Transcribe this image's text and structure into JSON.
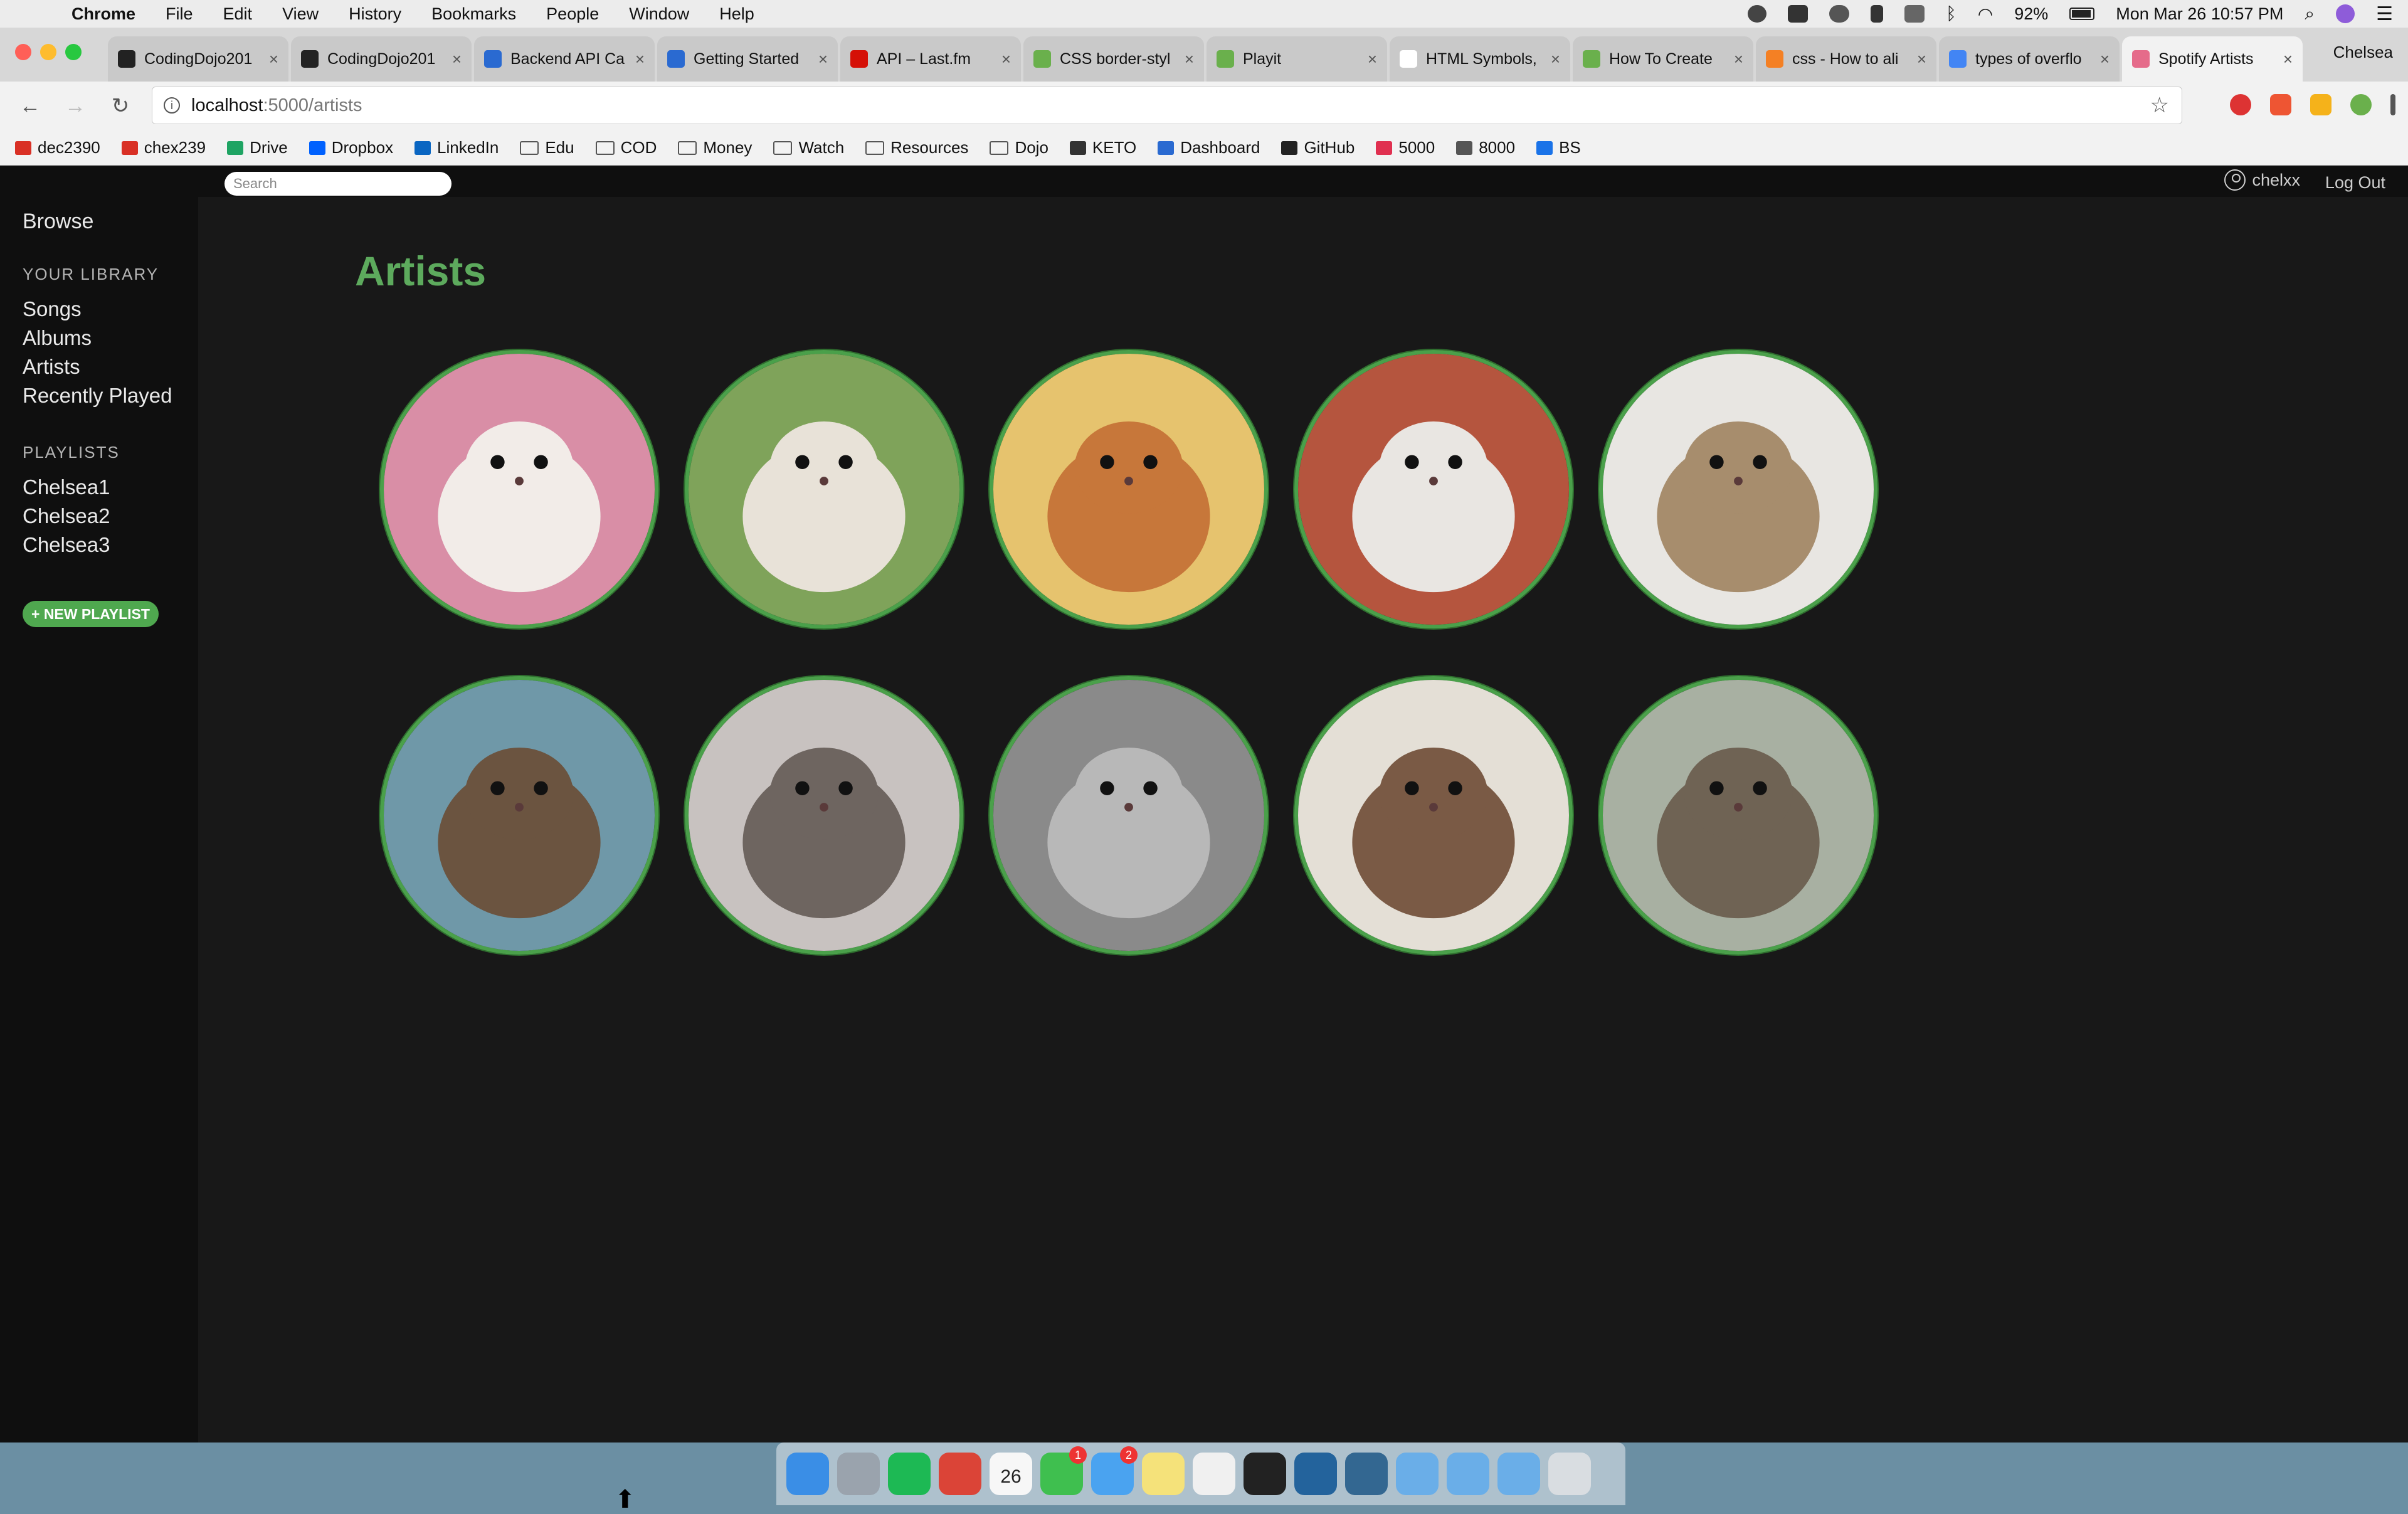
{
  "menubar": {
    "items": [
      {
        "label": "Chrome",
        "bold": true
      },
      {
        "label": "File"
      },
      {
        "label": "Edit"
      },
      {
        "label": "View"
      },
      {
        "label": "History"
      },
      {
        "label": "Bookmarks"
      },
      {
        "label": "People"
      },
      {
        "label": "Window"
      },
      {
        "label": "Help"
      }
    ],
    "battery": "92%",
    "clock": "Mon Mar 26  10:57 PM"
  },
  "chrome": {
    "tabs": [
      {
        "label": "CodingDojo201",
        "favicon_color": "#222222"
      },
      {
        "label": "CodingDojo201",
        "favicon_color": "#222222"
      },
      {
        "label": "Backend API Ca",
        "favicon_color": "#2a6ad1"
      },
      {
        "label": "Getting Started",
        "favicon_color": "#2a6ad1"
      },
      {
        "label": "API – Last.fm",
        "favicon_color": "#d51007"
      },
      {
        "label": "CSS border-styl",
        "favicon_color": "#6ab04c"
      },
      {
        "label": "Playit",
        "favicon_color": "#6ab04c"
      },
      {
        "label": "HTML Symbols,",
        "favicon_color": "#ffffff"
      },
      {
        "label": "How To Create",
        "favicon_color": "#6ab04c"
      },
      {
        "label": "css - How to ali",
        "favicon_color": "#f48024"
      },
      {
        "label": "types of overflo",
        "favicon_color": "#4285f4"
      },
      {
        "label": "Spotify Artists",
        "favicon_color": "#e56b8a",
        "active": true
      }
    ],
    "profile": "Chelsea",
    "url_host": "localhost",
    "url_path": ":5000/artists",
    "bookmarks": [
      {
        "label": "dec2390",
        "icon": "gmail-icon",
        "color": "#d93025"
      },
      {
        "label": "chex239",
        "icon": "gmail-icon",
        "color": "#d93025"
      },
      {
        "label": "Drive",
        "icon": "drive-icon",
        "color": "#1fa463"
      },
      {
        "label": "Dropbox",
        "icon": "dropbox-icon",
        "color": "#0061fe"
      },
      {
        "label": "LinkedIn",
        "icon": "linkedin-icon",
        "color": "#0a66c2"
      },
      {
        "label": "Edu",
        "icon": "folder-icon"
      },
      {
        "label": "COD",
        "icon": "folder-icon"
      },
      {
        "label": "Money",
        "icon": "folder-icon"
      },
      {
        "label": "Watch",
        "icon": "folder-icon"
      },
      {
        "label": "Resources",
        "icon": "folder-icon"
      },
      {
        "label": "Dojo",
        "icon": "folder-icon"
      },
      {
        "label": "KETO",
        "icon": "leaf-icon",
        "color": "#333333"
      },
      {
        "label": "Dashboard",
        "icon": "dashboard-icon",
        "color": "#2a6ad1"
      },
      {
        "label": "GitHub",
        "icon": "github-icon",
        "color": "#222222"
      },
      {
        "label": "5000",
        "icon": "heart-icon",
        "color": "#e03050"
      },
      {
        "label": "8000",
        "icon": "page-icon",
        "color": "#555555"
      },
      {
        "label": "BS",
        "icon": "bs-icon",
        "color": "#1a73e8"
      }
    ]
  },
  "app": {
    "search_placeholder": "Search",
    "username": "chelxx",
    "logout": "Log Out",
    "sidebar": {
      "browse": "Browse",
      "library_heading": "YOUR LIBRARY",
      "library_items": [
        "Songs",
        "Albums",
        "Artists",
        "Recently Played"
      ],
      "playlists_heading": "PLAYLISTS",
      "playlists": [
        "Chelsea1",
        "Chelsea2",
        "Chelsea3"
      ],
      "new_playlist": "+ NEW PLAYLIST"
    },
    "page_title": "Artists",
    "accent_color": "#5daa5d",
    "artists": [
      {
        "image": "white hamster on pink blanket",
        "bg": "#d98ea6",
        "animal": "#f2ece8"
      },
      {
        "image": "dwarf hamster on green",
        "bg": "#7fa35a",
        "animal": "#e8e2d8"
      },
      {
        "image": "golden hamster on yellow",
        "bg": "#e6c36e",
        "animal": "#c7773a"
      },
      {
        "image": "hamster in sweater held in hand",
        "bg": "#b5553e",
        "animal": "#e9e6e2"
      },
      {
        "image": "tabby kitten",
        "bg": "#e8e6e2",
        "animal": "#a78d6d"
      },
      {
        "image": "two sea otters in water",
        "bg": "#6f98a8",
        "animal": "#6b5440"
      },
      {
        "image": "baby otter held up",
        "bg": "#c8c2c0",
        "animal": "#6e6560"
      },
      {
        "image": "grey otter face close-up",
        "bg": "#8a8a8a",
        "animal": "#b8b8b8"
      },
      {
        "image": "otter standing",
        "bg": "#e4dfd6",
        "animal": "#7a5a45"
      },
      {
        "image": "two otters floating",
        "bg": "#a8b0a2",
        "animal": "#6f6354"
      }
    ]
  },
  "dock": {
    "icons": [
      {
        "name": "finder-icon",
        "color": "#3a8ee6"
      },
      {
        "name": "launchpad-icon",
        "color": "#9aa3ad"
      },
      {
        "name": "spotify-icon",
        "color": "#1db954"
      },
      {
        "name": "chrome-icon",
        "color": "#db4437"
      },
      {
        "name": "calendar-icon",
        "color": "#f7f7f7",
        "text": "26"
      },
      {
        "name": "facetime-icon",
        "color": "#3fbf4f",
        "badge": "1"
      },
      {
        "name": "messages-icon",
        "color": "#4aa3f0",
        "badge": "2"
      },
      {
        "name": "notes-icon",
        "color": "#f5e27a"
      },
      {
        "name": "textedit-icon",
        "color": "#f0f0f0"
      },
      {
        "name": "terminal-icon",
        "color": "#222222"
      },
      {
        "name": "vscode-icon",
        "color": "#23639c"
      },
      {
        "name": "postgres-icon",
        "color": "#336791"
      },
      {
        "name": "folder-icon",
        "color": "#6aaee8"
      },
      {
        "name": "folder-icon",
        "color": "#6aaee8"
      },
      {
        "name": "folder-icon",
        "color": "#6aaee8"
      },
      {
        "name": "trash-icon",
        "color": "#d9dde1"
      }
    ]
  }
}
